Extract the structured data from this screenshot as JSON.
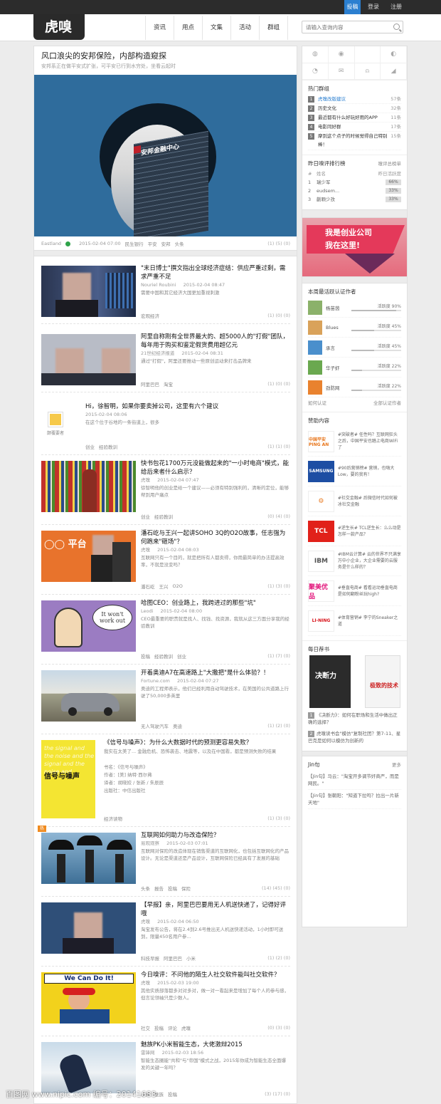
{
  "topbar": {
    "post": "投稿",
    "login": "登录",
    "register": "注册"
  },
  "logo": "虎嗅",
  "nav": [
    "资讯",
    "用点",
    "文集",
    "活动",
    "群组"
  ],
  "search": {
    "placeholder": "请输入查询内容"
  },
  "featured": {
    "title": "风口浪尖的安邦保险，内部构造窥探",
    "subtitle": "安邦系正在做平安式扩张，可平安已行到水穷处，坐看云起时",
    "image_text": "安邦金融中心",
    "author": "Eastland",
    "time": "2015-02-04 07:00",
    "tags": [
      "民生银行",
      "平安",
      "安邦",
      "头条"
    ],
    "counts": "(1)  (5)  (0)"
  },
  "articles": [
    {
      "title": "\"末日博士\"撰文指出全球经济症结：供应严重过剩，需求严重不足",
      "author": "Nouriel Roubini",
      "time": "2015-02-04 08:47",
      "desc": "需要中国和其它经济大国更加重视刺激",
      "tags": [
        "宏观经济"
      ],
      "counts": "(1)  (0)  (0)"
    },
    {
      "title": "阿里自称刚有全世界最大的、超5000人的\"打假\"团队，每年用于购买和鉴定假货费用超亿元",
      "author": "21世纪经济报道",
      "time": "2015-02-04 08:31",
      "desc": "通过\"打假\"，阿里还要推动一些原创运动来打击品牌来",
      "tags": [
        "阿里巴巴",
        "淘宝"
      ],
      "counts": "(1)  (0)  (0)"
    },
    {
      "title": "Hi，徐智明，如果你要卖掉公司，这里有六个建议",
      "author": "",
      "time": "2015-02-04 08:06",
      "desc": "在这个位于谷地的一条街道上，很多",
      "tags": [
        "创业",
        "经验教训"
      ],
      "counts": "(1)  (1)  (0)",
      "avatar_label": "颠覆要者"
    },
    {
      "title": "快书包花1700万元没能做起来的\"一小时电商\"模式，能给后来者什么启示？",
      "author": "虎嗅",
      "time": "2015-02-04 07:47",
      "desc": "徐智明他的创业是给一个建议——必须有特别强利的，清晰的定位，能够帮到用户痛点",
      "tags": [
        "创业",
        "经验教训"
      ],
      "counts": "(0)  (4)  (0)"
    },
    {
      "title": "潘石屹与王兴一起讲SOHO 3Q的O2O故事，任志强为何跑来\"砸场\"？",
      "author": "虎嗅",
      "time": "2015-02-04 08:03",
      "desc": "互联网只有一个目的，就是把所有人都卖得，你用最简单的办法提高效率，不就是没变吗？",
      "tags": [
        "潘石屹",
        "王兴",
        "O2O"
      ],
      "counts": "(1)  (3)  (0)"
    },
    {
      "title": "哈图CEO：创业路上，我跨进过的那些\"坑\"",
      "author": "Leodi",
      "time": "2015-02-04 08:00",
      "desc": "CEO最重要的职责就是找人、找钱、找资源，我就从这三方面分享我的经验教训",
      "tags": [
        "投稿",
        "经验教训",
        "创业"
      ],
      "counts": "(1)  (7)  (0)",
      "cartoon": "It won't work out"
    },
    {
      "title": "开着奥迪A7在高速路上\"大撒把\"是什么体验？！",
      "author": "Fortune.com",
      "time": "2015-02-04 07:27",
      "desc": "奥迪的工程师表示，他们已经利用自动驾驶技术，在美国的公共道路上行驶了50,000多英里",
      "tags": [
        "无人驾驶汽车",
        "奥迪"
      ],
      "counts": "(1)  (2)  (0)"
    },
    {
      "title": "《信号与噪声》：为什么大数据时代的预测更容易失败？",
      "author": "",
      "time": "",
      "desc": "我实在太美了... 金融危机、恐怖袭击、地震等，以及在中国看，都是预测失败的结果",
      "tags": [
        "经济读物"
      ],
      "counts": "(1)  (3)  (0)",
      "book": {
        "title": "书名：《信号与噪声》",
        "author": "作者：[美] 纳特·西尔弗",
        "translator": "译者：胡晓姣 / 张新 / 朱辰辰",
        "publisher": "出版社：中信出版社",
        "cover_title": "信号与噪声"
      }
    },
    {
      "title": "互联网如何助力与改造保险？",
      "author": "易观观察",
      "time": "2015-02-03 07:01",
      "desc": "互联网对保险的改造体现在销售渠道的互联网化，也包括互联网化的产品设计。无论是渠道还是产品设计，互联网保险已经具有了发展的基础",
      "tags": [
        "头条",
        "报告",
        "投稿",
        "保险"
      ],
      "counts": "(14)  (45)  (0)",
      "hot": "热"
    },
    {
      "title": "【早报】亲，阿里巴巴要用无人机送快递了，记得好评哦",
      "author": "虎嗅",
      "time": "2015-02-04 06:50",
      "desc": "淘宝发布公告，将在2.4到2.6号推出无人机送快递活动，1小时即可送到，限量450名用户参...",
      "tags": [
        "科技早报",
        "阿里巴巴",
        "小米"
      ],
      "counts": "(1)  (2)  (0)"
    },
    {
      "title": "今日嗅评：不问他的陌生人社交软件能叫社交软件？",
      "author": "虎嗅",
      "time": "2015-02-03 19:00",
      "desc": "其他实质部落都多对对多对，做一对一看起来是增加了每个人的参与感，但言论领袖只是少数人。",
      "tags": [
        "社交",
        "投稿",
        "评论",
        "虎嗅"
      ],
      "counts": "(0)  (3)  (0)",
      "poster": "We Can Do It!"
    },
    {
      "title": "魅族PK小米智能生态，大佬激辩2015",
      "author": "雷锋网",
      "time": "2015-02-03 18:56",
      "desc": "智能生态圈能\"共和\"与\"帝国\"模式之战，2015年你成为智能生态全面爆发的关键一年吗？",
      "tags": [
        "小米",
        "魅族",
        "投稿"
      ],
      "counts": "(3)  (17)  (0)"
    }
  ],
  "sidebar": {
    "share_icons": [
      "◍",
      "◉",
      "",
      "◐",
      "◔",
      "✉",
      "⍝",
      "◢"
    ],
    "hot_groups": {
      "title": "热门群组",
      "items": [
        {
          "n": "1",
          "name": "虎嗅改版建议",
          "count": "57条"
        },
        {
          "n": "2",
          "name": "历史文化",
          "count": "32条"
        },
        {
          "n": "3",
          "name": "最近都有什么好玩好用的APP",
          "count": "11条"
        },
        {
          "n": "4",
          "name": "电影同好群",
          "count": "17条"
        },
        {
          "n": "5",
          "name": "摩到这个点子的时候觉得自己特别棒！",
          "count": "15条"
        }
      ]
    },
    "ranking": {
      "title": "昨日嗅评排行榜",
      "more": "嗅评总榜单",
      "head_no": "#",
      "head_name": "姓名",
      "head_val": "昨日活跃度",
      "items": [
        {
          "n": "1",
          "name": "瑞少军",
          "val": "66%"
        },
        {
          "n": "2",
          "name": "eudsem...",
          "val": "33%"
        },
        {
          "n": "3",
          "name": "蒯颗少孜",
          "val": "33%"
        }
      ]
    },
    "ad": {
      "line1": "我是创业公司",
      "line2": "我在这里!"
    },
    "users": {
      "title": "本周最活跃认证作者",
      "items": [
        {
          "name": "杨苗茵",
          "label": "活跃度",
          "val": "90%",
          "frac": 0.9
        },
        {
          "name": "Blues",
          "label": "活跃度",
          "val": "45%",
          "frac": 0.45
        },
        {
          "name": "承言",
          "label": "活跃度",
          "val": "45%",
          "frac": 0.45
        },
        {
          "name": "华子虾",
          "label": "活跃度",
          "val": "22%",
          "frac": 0.22
        },
        {
          "name": "劲防网",
          "label": "活跃度",
          "val": "22%",
          "frac": 0.22
        }
      ],
      "link_left": "如何认证",
      "link_right": "全部认证作者"
    },
    "sponsor": {
      "title": "赞助内容",
      "items": [
        {
          "brand": "中国平安 PING AN",
          "text": "#突破者# 任性吗？互联网狂头之后，中国平安也踏上电商WiFi了",
          "color": "#e8751a",
          "bg": "#fff"
        },
        {
          "brand": "SAMSUNG",
          "text": "#90后营销榜# 营销，也嗨大Low，要的我有！",
          "color": "#fff",
          "bg": "#1d4ea3"
        },
        {
          "brand": "⚙",
          "text": "#社交金融# 后微信时代如何被冰社交金融",
          "color": "#e97b22",
          "bg": "#fff"
        },
        {
          "brand": "TCL",
          "text": "#逆生长# TCL逆生长：么么动是怎样一款产品？",
          "color": "#fff",
          "bg": "#e1211a"
        },
        {
          "brand": "IBM",
          "text": "#IBM云计算# 云的世界不只满享万中小企业，大企业需要的云服务是什么样的？",
          "color": "#555",
          "bg": "#fff"
        },
        {
          "brand": "聚美优品",
          "text": "#垂直电商# 看看运动垂直电商是如何翻粉丝玩high?",
          "color": "#e3197d",
          "bg": "#fff"
        },
        {
          "brand": "LI-NING",
          "text": "#体育营销# 李宁的Sneaker之道",
          "color": "#d8121a",
          "bg": "#fff"
        }
      ]
    },
    "books": {
      "title": "每日荐书",
      "cover1": "决断力",
      "cover2": "极致的技术",
      "items": [
        {
          "n": "1",
          "text": "《决断力》：如何在职场和生活中做出正确的选择？"
        },
        {
          "n": "2",
          "text": "虎嗅读书会\"模仿\"复制社团？第7-11、星巴克是如何以模仿为创新的"
        }
      ]
    },
    "jin": {
      "title": "Jin句",
      "more": "更多",
      "items": [
        "【Jin句】马云：\"淘宝开多调节奸商严，而是网民。\"",
        "【Jin句】张朝阳：\"知道下拉吗？拉出一片新天地\""
      ]
    }
  },
  "watermark": "百图网 www.nipic.com  编号：20141688"
}
